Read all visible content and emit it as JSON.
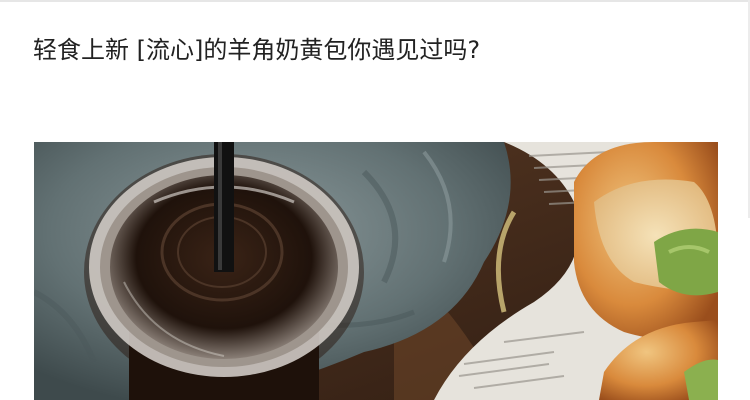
{
  "article": {
    "title": "轻食上新 [流心]的羊角奶黄包你遇见过吗?"
  },
  "image": {
    "subject": "photo-drink-and-croissant"
  }
}
